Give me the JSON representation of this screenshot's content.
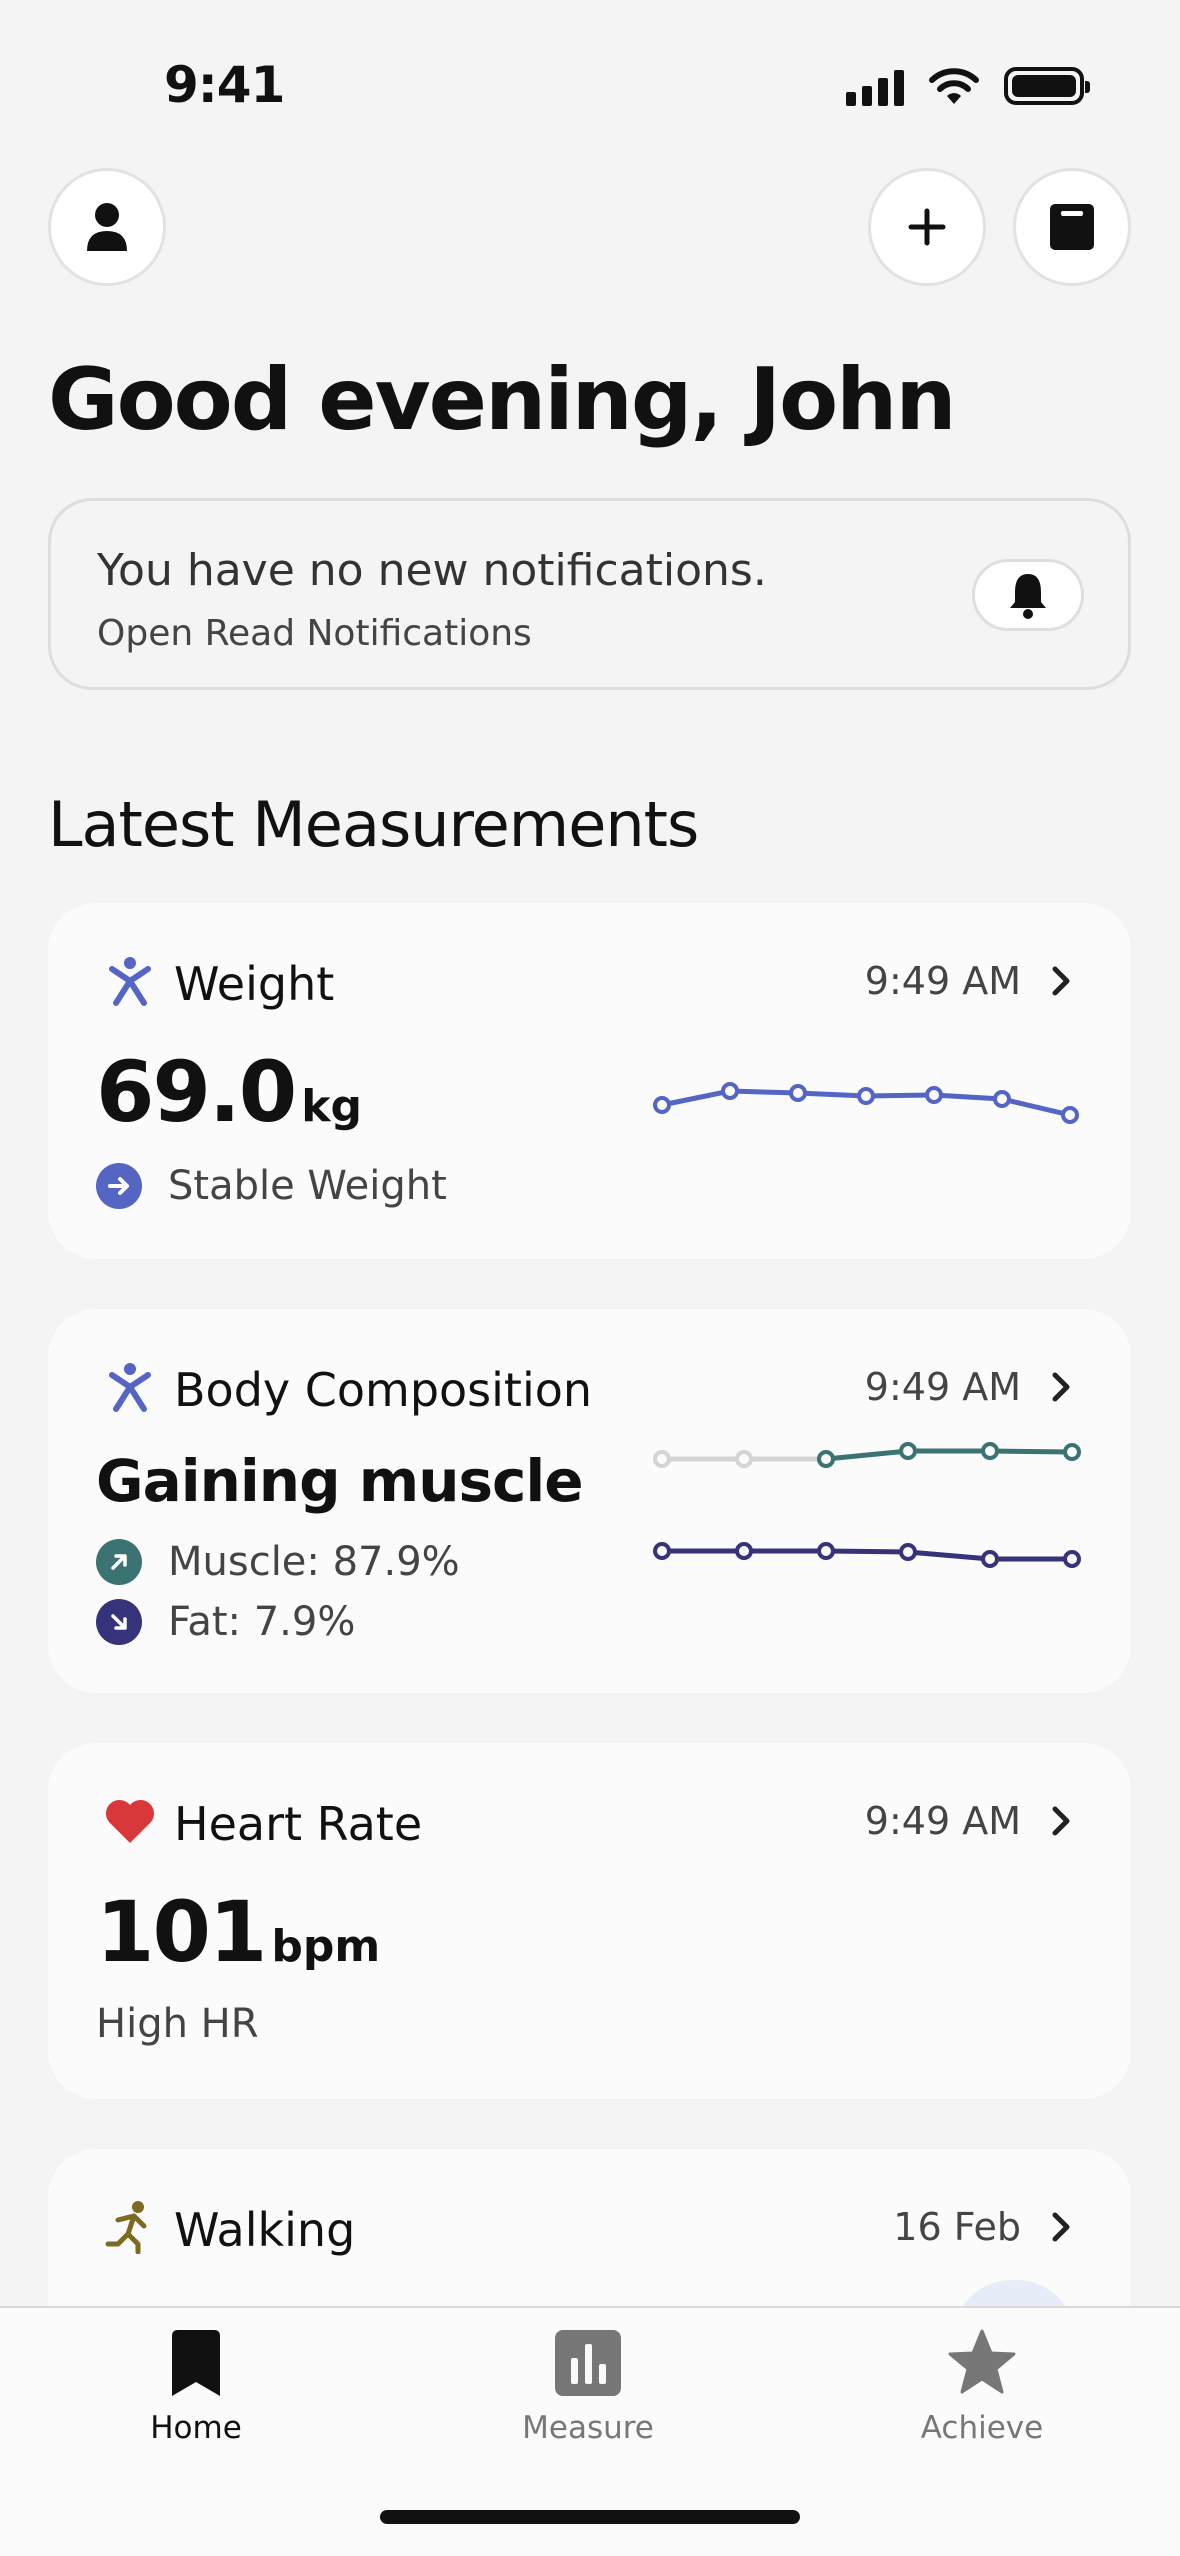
{
  "status_bar": {
    "time": "9:41"
  },
  "header": {
    "greeting": "Good evening, John"
  },
  "notification": {
    "title": "You have no new notifications.",
    "link": "Open Read Notifications"
  },
  "section_title": "Latest Measurements",
  "cards": {
    "weight": {
      "title": "Weight",
      "time": "9:49 AM",
      "value": "69.0",
      "unit": "kg",
      "status": "Stable Weight",
      "accent": "#5565c4"
    },
    "body": {
      "title": "Body Composition",
      "time": "9:49 AM",
      "headline": "Gaining muscle",
      "muscle": "Muscle: 87.9%",
      "fat": "Fat: 7.9%",
      "muscle_color": "#3a7371",
      "fat_color": "#36337a"
    },
    "heart": {
      "title": "Heart Rate",
      "time": "9:49 AM",
      "value": "101",
      "unit": "bpm",
      "status": "High HR",
      "accent": "#d9383a"
    },
    "walking": {
      "title": "Walking",
      "date": "16 Feb",
      "accent": "#7b6a1f"
    }
  },
  "tabs": [
    {
      "label": "Home",
      "icon": "bookmark-icon",
      "active": true
    },
    {
      "label": "Measure",
      "icon": "bar-chart-icon",
      "active": false
    },
    {
      "label": "Achieve",
      "icon": "star-icon",
      "active": false
    }
  ]
}
